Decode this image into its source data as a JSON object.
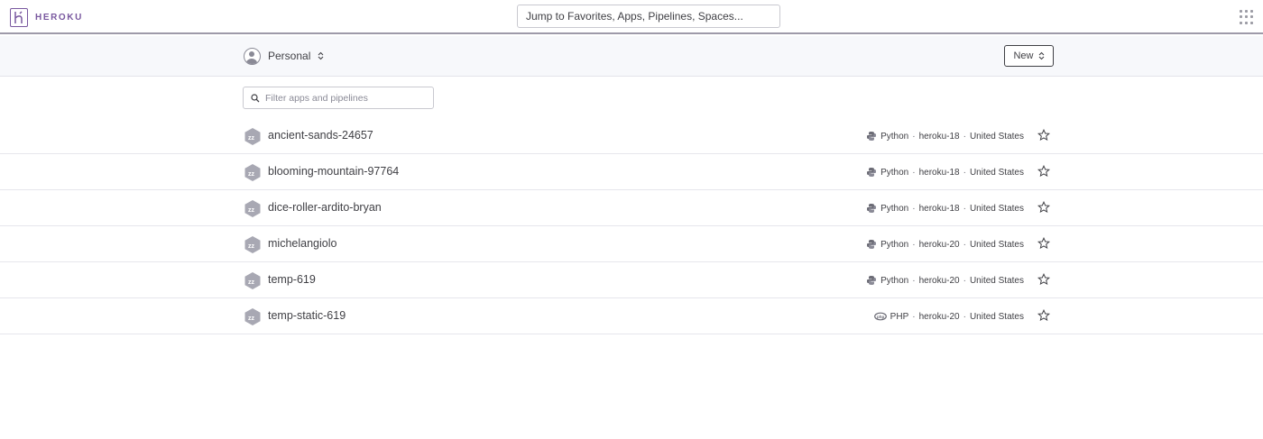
{
  "header": {
    "logo_text": "HEROKU",
    "search_placeholder": "Jump to Favorites, Apps, Pipelines, Spaces..."
  },
  "subheader": {
    "account_label": "Personal",
    "new_button": "New"
  },
  "filter": {
    "placeholder": "Filter apps and pipelines"
  },
  "apps": [
    {
      "name": "ancient-sands-24657",
      "language": "Python",
      "stack": "heroku-18",
      "region": "United States"
    },
    {
      "name": "blooming-mountain-97764",
      "language": "Python",
      "stack": "heroku-18",
      "region": "United States"
    },
    {
      "name": "dice-roller-ardito-bryan",
      "language": "Python",
      "stack": "heroku-18",
      "region": "United States"
    },
    {
      "name": "michelangiolo",
      "language": "Python",
      "stack": "heroku-20",
      "region": "United States"
    },
    {
      "name": "temp-619",
      "language": "Python",
      "stack": "heroku-20",
      "region": "United States"
    },
    {
      "name": "temp-static-619",
      "language": "PHP",
      "stack": "heroku-20",
      "region": "United States"
    }
  ],
  "separator": "·",
  "colors": {
    "brand": "#79589f",
    "text": "#3f3f44",
    "subheader_bg": "#f7f8fb"
  }
}
